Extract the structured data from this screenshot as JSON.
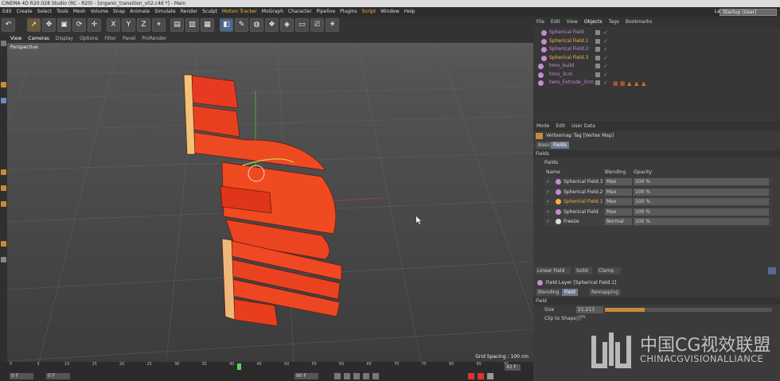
{
  "title": "CINEMA 4D R20.028 Studio (RC - R20) - [organic_transition_v02.c4d *] - Main",
  "menu": [
    "Edit",
    "Create",
    "Select",
    "Tools",
    "Mesh",
    "Volume",
    "Snap",
    "Animate",
    "Simulate",
    "Render",
    "Sculpt",
    "Motion Tracker",
    "MoGraph",
    "Character",
    "Pipeline",
    "Plugins",
    "Script",
    "Window",
    "Help"
  ],
  "layout_label": "Layout:",
  "layout_value": "Startup (User)",
  "toolbar": {
    "x": "X",
    "y": "Y",
    "z": "Z"
  },
  "viewport": {
    "menu": [
      "View",
      "Cameras",
      "Display",
      "Options",
      "Filter",
      "Panel",
      "ProRender"
    ],
    "label": "Perspective",
    "grid_spacing": "Grid Spacing : 100 cm"
  },
  "timeline": {
    "ticks": [
      "0",
      "5",
      "10",
      "15",
      "20",
      "25",
      "30",
      "35",
      "40",
      "45",
      "50",
      "55",
      "60",
      "65",
      "70",
      "75",
      "80",
      "85",
      "90"
    ],
    "end": "42 F",
    "start": "0 F",
    "field2": "0 F",
    "field3": "90 F"
  },
  "object_manager": {
    "menu": [
      "File",
      "Edit",
      "View",
      "Objects",
      "Tags",
      "Bookmarks"
    ],
    "items": [
      {
        "name": "Spherical Field",
        "color": "#c88ad8"
      },
      {
        "name": "Spherical Field.1",
        "color": "#f7b33b"
      },
      {
        "name": "Spherical Field.2",
        "color": "#c88ad8"
      },
      {
        "name": "Spherical Field.3",
        "color": "#f7b33b"
      },
      {
        "name": "hmo_build",
        "color": "#c88ad8"
      },
      {
        "name": "hmo_3cm",
        "color": "#c88ad8"
      },
      {
        "name": "hero_Extrude_3cm",
        "color": "#c88ad8"
      }
    ]
  },
  "attribute_manager": {
    "menu": [
      "Mode",
      "Edit",
      "User Data"
    ],
    "tag_title": "Vertexmap Tag [Vertex Map]",
    "tabs": [
      "Basic",
      "Fields"
    ],
    "section": "Fields",
    "fields_label": "Fields",
    "columns": [
      "Name",
      "Blending",
      "Opacity"
    ],
    "rows": [
      {
        "name": "Spherical Field.3",
        "blend": "Max",
        "opacity": "100 %",
        "color": "#c88ad8"
      },
      {
        "name": "Spherical Field.2",
        "blend": "Max",
        "opacity": "100 %",
        "color": "#c88ad8"
      },
      {
        "name": "Spherical Field.1",
        "blend": "Max",
        "opacity": "100 %",
        "color": "#f7b33b"
      },
      {
        "name": "Spherical Field",
        "blend": "Max",
        "opacity": "100 %",
        "color": "#c88ad8"
      },
      {
        "name": "Freeze",
        "blend": "Normal",
        "opacity": "100 %",
        "color": "#dddddd"
      }
    ]
  },
  "field_layer": {
    "buttons": [
      "Linear Field",
      "Solid",
      "Clamp"
    ],
    "title": "Field Layer [Spherical Field.1]",
    "tabs": [
      "Blending",
      "Field",
      "Remapping"
    ],
    "section": "Field",
    "size_label": "Size",
    "size_value": "21.213 cm",
    "clip_label": "Clip to Shape"
  },
  "watermark": {
    "cn": "中国CG视效联盟",
    "en": "CHINACGVISIONALLIANCE"
  }
}
